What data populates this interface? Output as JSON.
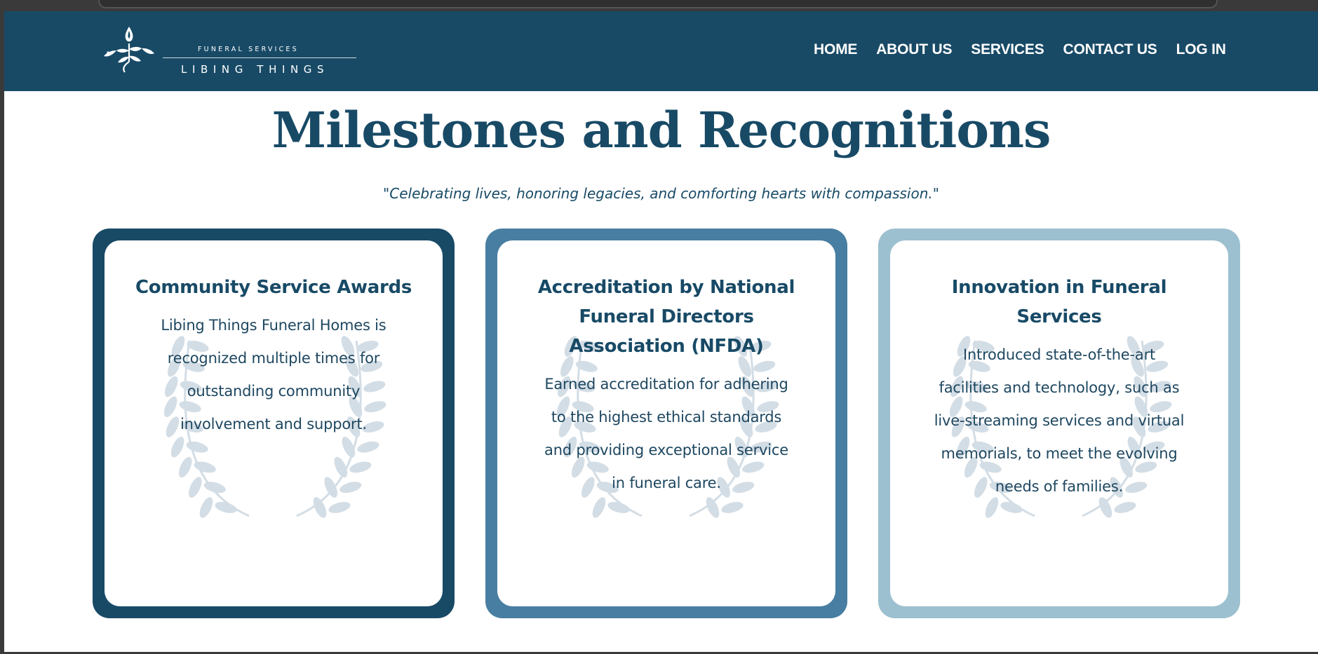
{
  "brand": {
    "tagline": "FUNERAL SERVICES",
    "name": "LIBING THINGS",
    "colors": {
      "primary": "#184a66",
      "mid": "#487ea2",
      "light": "#9cc0cf"
    }
  },
  "nav": {
    "items": [
      {
        "label": "HOME"
      },
      {
        "label": "ABOUT US"
      },
      {
        "label": "SERVICES"
      },
      {
        "label": "CONTACT US"
      },
      {
        "label": "LOG IN"
      }
    ]
  },
  "main": {
    "title": "Milestones and Recognitions",
    "subtitle": "\"Celebrating lives, honoring legacies, and comforting hearts with compassion.\""
  },
  "cards": [
    {
      "title": "Community Service Awards",
      "body": "Libing Things Funeral Homes is recognized multiple times for outstanding community involvement and support.",
      "icon": "laurel-wreath-icon"
    },
    {
      "title": "Accreditation by National Funeral Directors Association (NFDA)",
      "body": "Earned accreditation for adhering to the highest ethical standards and providing exceptional service in funeral care.",
      "icon": "laurel-wreath-icon"
    },
    {
      "title": "Innovation in Funeral Services",
      "body": "Introduced state-of-the-art facilities and technology, such as live-streaming services and virtual memorials, to meet the evolving needs of families.",
      "icon": "laurel-wreath-icon"
    }
  ]
}
